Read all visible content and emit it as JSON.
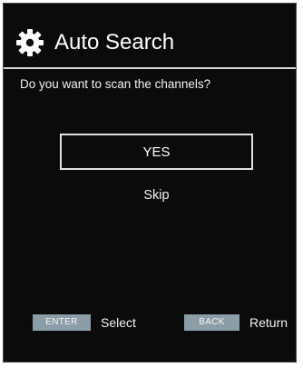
{
  "screen": {
    "title": "Auto Search",
    "title_icon": "gear-icon",
    "prompt": "Do you want to scan the channels?",
    "options": {
      "yes_label": "YES",
      "skip_label": "Skip"
    }
  },
  "footer": {
    "enter_key": "ENTER",
    "enter_action": "Select",
    "back_key": "BACK",
    "back_action": "Return"
  },
  "colors": {
    "background": "#0b0b0b",
    "text": "#f2f2f2",
    "key_badge": "#8b9da6",
    "divider": "#d8d8d8"
  }
}
